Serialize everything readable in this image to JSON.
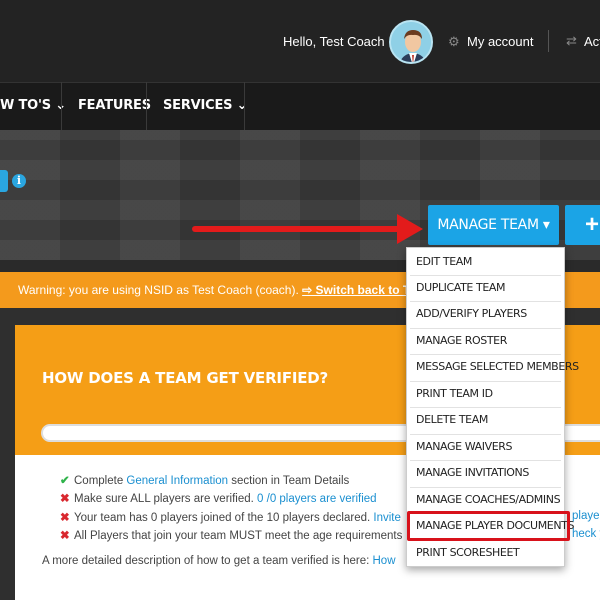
{
  "header": {
    "greeting": "Hello, Test Coach",
    "my_account": "My account",
    "action_partial": "Act",
    "gear_icon": "⚙",
    "swap_icon": "⇄"
  },
  "nav": {
    "items": [
      {
        "label": "W TO'S ⌄"
      },
      {
        "label": "FEATURES"
      },
      {
        "label": "SERVICES ⌄"
      }
    ]
  },
  "toolbar": {
    "manage_team": "MANAGE TEAM ▾",
    "add": "+"
  },
  "warning": {
    "text": "Warning: you are using NSID as Test Coach (coach). ",
    "link": "⇨ Switch back to Test"
  },
  "verification": {
    "title": "HOW DOES A TEAM GET VERIFIED?",
    "requirements": [
      {
        "mark": "✔",
        "status": "ok",
        "text": "Complete ",
        "link": "General Information",
        "after": " section in Team Details"
      },
      {
        "mark": "✖",
        "status": "bad",
        "text": "Make sure ALL players are verified. ",
        "link": "0 /0 players are verified",
        "after": ""
      },
      {
        "mark": "✖",
        "status": "bad",
        "text": "Your team has 0 players joined of the 10 players declared. ",
        "link": "Invite",
        "after": ""
      },
      {
        "mark": "✖",
        "status": "bad",
        "text": "All Players that join your team MUST meet the age requirements",
        "link": "",
        "after": ""
      }
    ],
    "more_text": "A more detailed description of how to get a team verified is here: ",
    "more_link": "How",
    "right_fragments": [
      "players",
      "heck y"
    ]
  },
  "dropdown": {
    "items": [
      "EDIT TEAM",
      "DUPLICATE TEAM",
      "ADD/VERIFY PLAYERS",
      "MANAGE ROSTER",
      "MESSAGE SELECTED MEMBERS",
      "PRINT TEAM ID",
      "DELETE TEAM",
      "MANAGE WAIVERS",
      "MANAGE INVITATIONS",
      "MANAGE COACHES/ADMINS",
      "MANAGE PLAYER DOCUMENTS",
      "PRINT SCORESHEET"
    ],
    "highlighted": "MANAGE PLAYER DOCUMENTS"
  },
  "colors": {
    "accent_blue": "#1ba4e6",
    "warning_orange": "#f49a1c",
    "arrow_red": "#e31b1b"
  }
}
